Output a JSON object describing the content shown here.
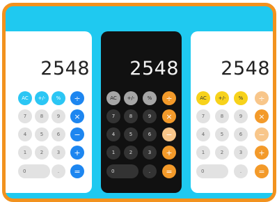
{
  "calculators": [
    {
      "id": "blue",
      "theme": "light",
      "display": "2548",
      "keys": {
        "ac": "AC",
        "sign": "+/-",
        "percent": "%",
        "divide": "÷",
        "seven": "7",
        "eight": "8",
        "nine": "9",
        "multiply": "×",
        "four": "4",
        "five": "5",
        "six": "6",
        "minus": "−",
        "one": "1",
        "two": "2",
        "three": "3",
        "plus": "+",
        "zero": "0",
        "decimal": ".",
        "equals": "="
      }
    },
    {
      "id": "dark",
      "theme": "dark",
      "display": "2548",
      "keys": {
        "ac": "AC",
        "sign": "+/-",
        "percent": "%",
        "divide": "÷",
        "seven": "7",
        "eight": "8",
        "nine": "9",
        "multiply": "×",
        "four": "4",
        "five": "5",
        "six": "6",
        "minus": "−",
        "one": "1",
        "two": "2",
        "three": "3",
        "plus": "+",
        "zero": "0",
        "decimal": ".",
        "equals": "="
      }
    },
    {
      "id": "yellow",
      "theme": "light",
      "display": "2548",
      "keys": {
        "ac": "AC",
        "sign": "+/-",
        "percent": "%",
        "divide": "÷",
        "seven": "7",
        "eight": "8",
        "nine": "9",
        "multiply": "×",
        "four": "4",
        "five": "5",
        "six": "6",
        "minus": "−",
        "one": "1",
        "two": "2",
        "three": "3",
        "plus": "+",
        "zero": "0",
        "decimal": ".",
        "equals": "="
      }
    }
  ],
  "colors": {
    "frame_border": "#f2921e",
    "background": "#1fc9f0",
    "blue_function": "#2bc6f4",
    "blue_operator": "#1d86f0",
    "dark_function": "#a6a6a6",
    "dark_number": "#333333",
    "yellow_function": "#f7d21b",
    "orange_operator": "#f39a2a"
  }
}
